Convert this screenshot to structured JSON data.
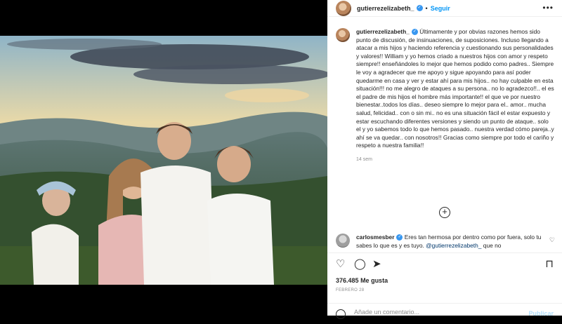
{
  "header": {
    "username": "gutierrezelizabeth_",
    "separator": "•",
    "follow_label": "Seguir",
    "more_label": "•••"
  },
  "caption": {
    "username": "gutierrezelizabeth_",
    "text": " Últimamente y por obvias razones hemos sido punto de discusión, de insinuaciones, de suposiciones. Incluso llegando a atacar a mis hijos y haciendo referencia y cuestionando sus personalidades y valores!! William y yo hemos criado a nuestros hijos con amor y respeto siempre!! enseñándoles lo mejor que hemos podido como padres.. Siempre le voy a agradecer que me apoyo y sigue apoyando para así poder quedarme en casa y ver y estar ahí para mis hijos.. no hay culpable en esta situación!!! no me alegro de ataques a su persona.. no lo agradezco!!.. el es el padre de mis hijos el hombre más importante!! el que ve por nuestro bienestar..todos los días.. deseo siempre lo mejor para el.. amor.. mucha salud, felicidad.. con o sin mi.. no es una situación fácil el estar expuesto y estar escuchando diferentes versiones y siendo un punto de ataque.. solo el y yo sabemos todo lo que hemos pasado.. nuestra verdad cómo pareja..y ahí se va quedar.. con nosotros!! Gracias como siempre por todo el cariño y respeto a nuestra familia!!",
    "time": "14 sem"
  },
  "load_more_icon": "plus-circle-icon",
  "comment": {
    "username": "carlosmesber",
    "text": " Eres tan hermosa por dentro como por fuera, solo tu sabes lo que es y es tuyo. ",
    "mention": "@gutierrezelizabeth_",
    "after_mention": " que no"
  },
  "actions": {
    "like_icon": "heart-icon",
    "comment_icon": "comment-icon",
    "share_icon": "send-icon",
    "save_icon": "bookmark-icon"
  },
  "likes_count": "376.485",
  "likes_label": "Me gusta",
  "post_date": "FEBRERO 28",
  "add_comment": {
    "placeholder": "Añade un comentario...",
    "publish_label": "Publicar"
  },
  "colors": {
    "accent": "#0095f6",
    "verified": "#3897f0",
    "publish_disabled": "#b2dffc"
  }
}
